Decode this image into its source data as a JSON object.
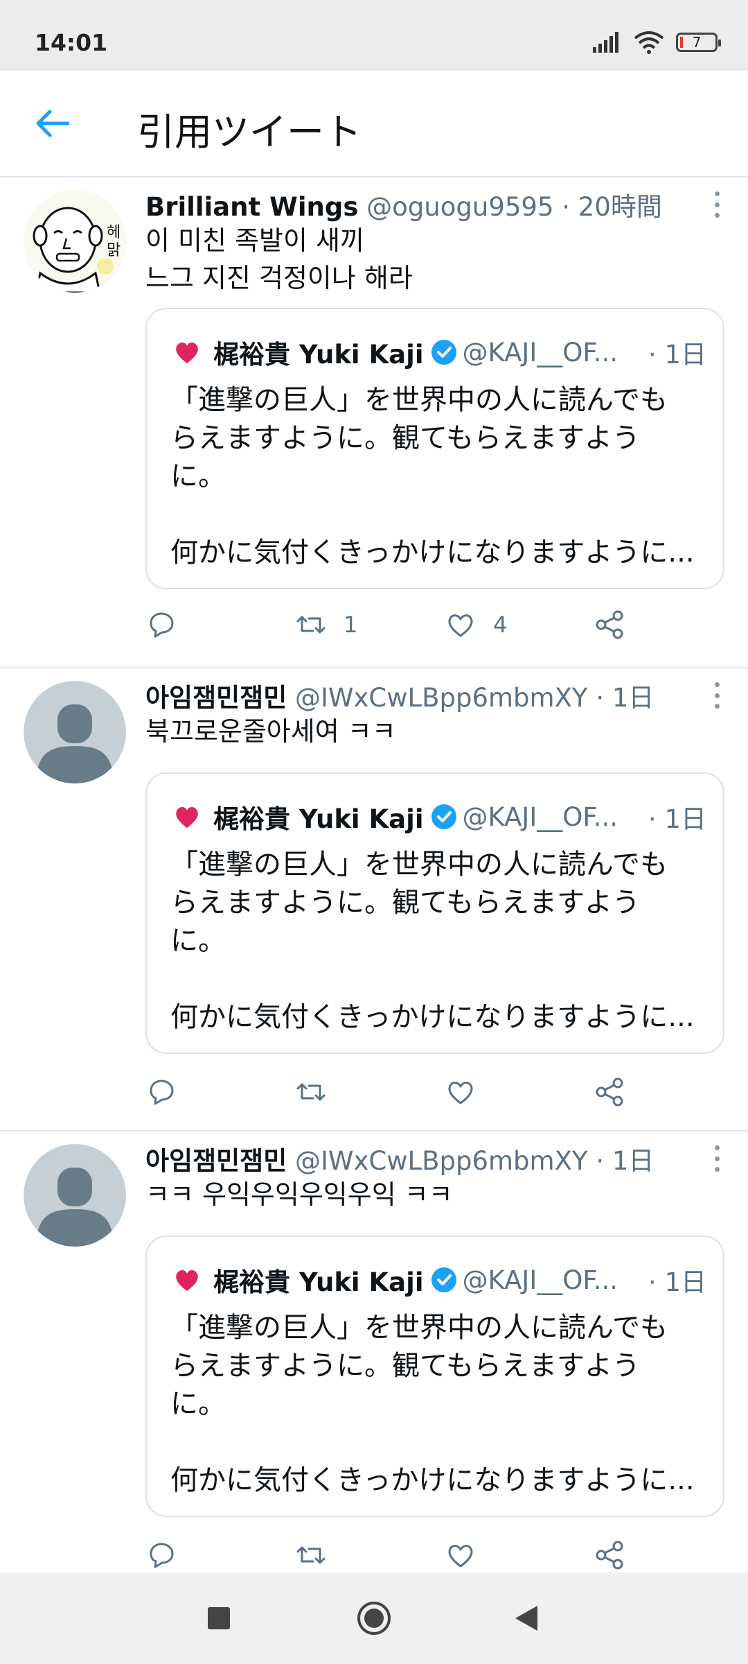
{
  "status": {
    "time": "14:01",
    "battery": "7"
  },
  "header": {
    "title": "引用ツイート"
  },
  "quoted": {
    "name": "梶裕貴 Yuki Kaji",
    "handle": "@KAJI__OF...",
    "date": "· 1日",
    "text_lines": [
      "「進撃の巨人」を世界中の人に読んでも",
      "らえますように。観てもらえますよう",
      "に。",
      "",
      "何かに気付くきっかけになりますように..."
    ]
  },
  "tweets": [
    {
      "name": "Brilliant Wings",
      "handle": "@oguogu9595",
      "time": "· 20時間",
      "text_lines": [
        "이 미친 족발이 새끼",
        "느그 지진 걱정이나 해라"
      ],
      "retweet_count": "1",
      "like_count": "4",
      "avatar_icon": "cartoon-face-avatar"
    },
    {
      "name": "아임잼민잼민",
      "handle": "@IWxCwLBpp6mbmXY",
      "time": "· 1日",
      "text_lines": [
        "북끄로운줄아세여 ㅋㅋ"
      ],
      "retweet_count": "",
      "like_count": "",
      "avatar_icon": "default-user-avatar"
    },
    {
      "name": "아임잼민잼민",
      "handle": "@IWxCwLBpp6mbmXY",
      "time": "· 1日",
      "text_lines": [
        "ㅋㅋ 우익우익우익우익 ㅋㅋ"
      ],
      "retweet_count": "",
      "like_count": "",
      "avatar_icon": "default-user-avatar"
    }
  ],
  "colors": {
    "accent": "#1da1f2",
    "muted": "#5b7083",
    "divider": "#e1e8ed",
    "heart": "#e0245e"
  }
}
